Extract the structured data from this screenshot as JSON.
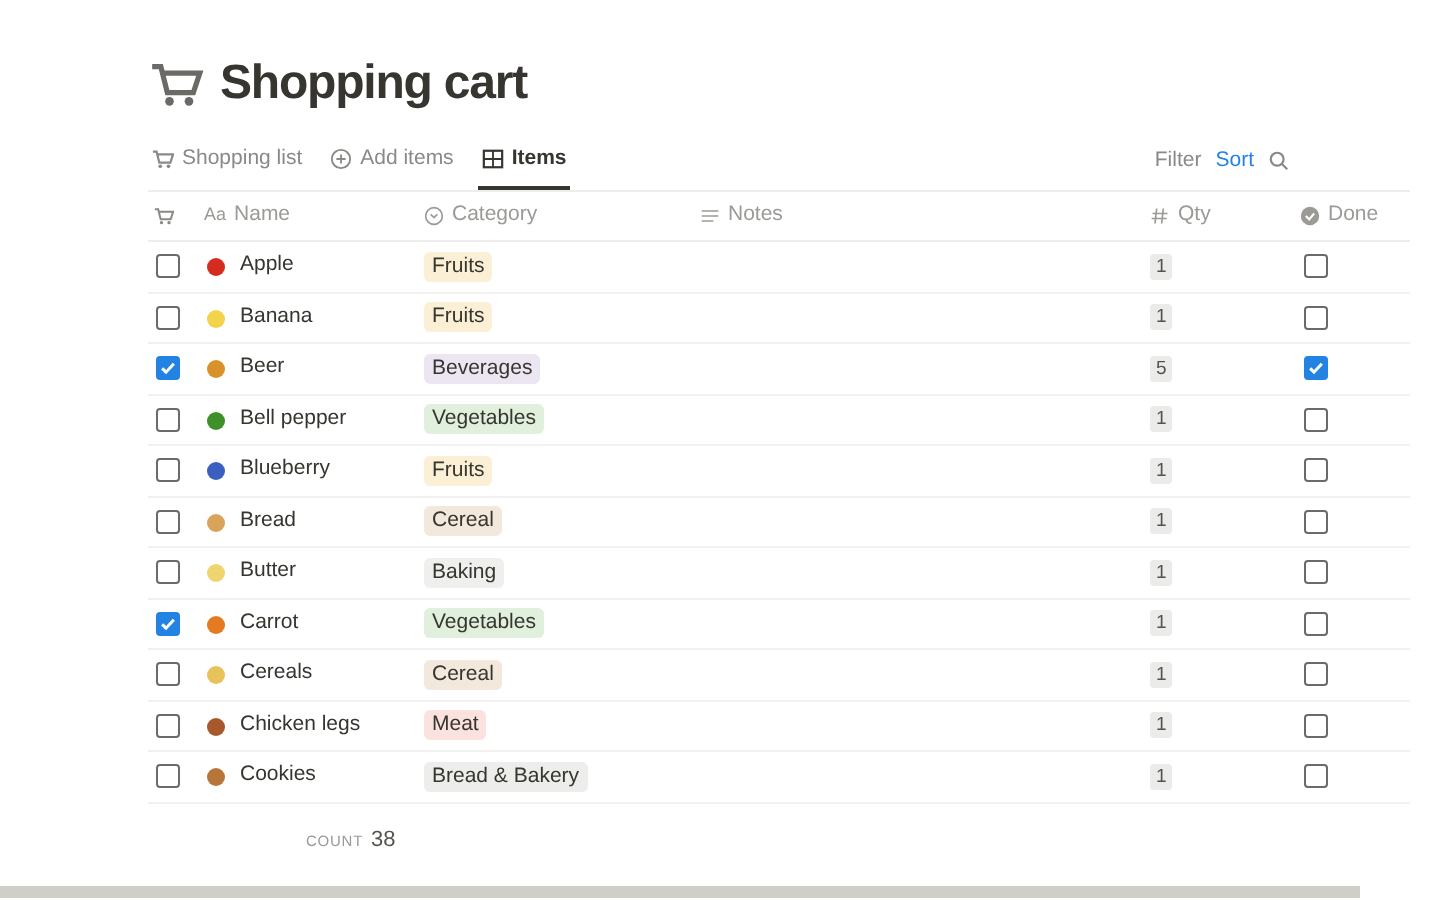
{
  "title": "Shopping cart",
  "views": [
    {
      "label": "Shopping list",
      "kind": "cart",
      "selected": false
    },
    {
      "label": "Add items",
      "kind": "plus",
      "selected": false
    },
    {
      "label": "Items",
      "kind": "table",
      "selected": true
    }
  ],
  "toolbar": {
    "filter": "Filter",
    "sort": "Sort"
  },
  "columns": [
    {
      "kind": "cart"
    },
    {
      "label": "Name",
      "kind": "title",
      "prefix": "Aa"
    },
    {
      "label": "Category",
      "kind": "select"
    },
    {
      "label": "Notes",
      "kind": "text"
    },
    {
      "label": "Qty",
      "kind": "number"
    },
    {
      "label": "Done",
      "kind": "check"
    }
  ],
  "rows": [
    {
      "checked": false,
      "name": "Apple",
      "color": "#d62b1f",
      "category": {
        "label": "Fruits",
        "color": "#fbf0d5"
      },
      "qty": "1",
      "done": false
    },
    {
      "checked": false,
      "name": "Banana",
      "color": "#f2d34a",
      "category": {
        "label": "Fruits",
        "color": "#fbf0d5"
      },
      "qty": "1",
      "done": false
    },
    {
      "checked": true,
      "name": "Beer",
      "color": "#d9922a",
      "category": {
        "label": "Beverages",
        "color": "#ece6f3"
      },
      "qty": "5",
      "done": true
    },
    {
      "checked": false,
      "name": "Bell pepper",
      "color": "#3f8f2a",
      "category": {
        "label": "Vegetables",
        "color": "#e0f0dc"
      },
      "qty": "1",
      "done": false
    },
    {
      "checked": false,
      "name": "Blueberry",
      "color": "#3b5fc0",
      "category": {
        "label": "Fruits",
        "color": "#fbf0d5"
      },
      "qty": "1",
      "done": false
    },
    {
      "checked": false,
      "name": "Bread",
      "color": "#d8a35a",
      "category": {
        "label": "Cereal",
        "color": "#f3e8dc"
      },
      "qty": "1",
      "done": false
    },
    {
      "checked": false,
      "name": "Butter",
      "color": "#f0d470",
      "category": {
        "label": "Baking",
        "color": "#efefed"
      },
      "qty": "1",
      "done": false
    },
    {
      "checked": true,
      "name": "Carrot",
      "color": "#e57a22",
      "category": {
        "label": "Vegetables",
        "color": "#e0f0dc"
      },
      "qty": "1",
      "done": false
    },
    {
      "checked": false,
      "name": "Cereals",
      "color": "#e8c25a",
      "category": {
        "label": "Cereal",
        "color": "#f3e8dc"
      },
      "qty": "1",
      "done": false
    },
    {
      "checked": false,
      "name": "Chicken legs",
      "color": "#a8582a",
      "category": {
        "label": "Meat",
        "color": "#fbe2de"
      },
      "qty": "1",
      "done": false
    },
    {
      "checked": false,
      "name": "Cookies",
      "color": "#b8753a",
      "category": {
        "label": "Bread & Bakery",
        "color": "#ededeb"
      },
      "qty": "1",
      "done": false
    }
  ],
  "footer": {
    "label": "COUNT",
    "value": "38"
  }
}
